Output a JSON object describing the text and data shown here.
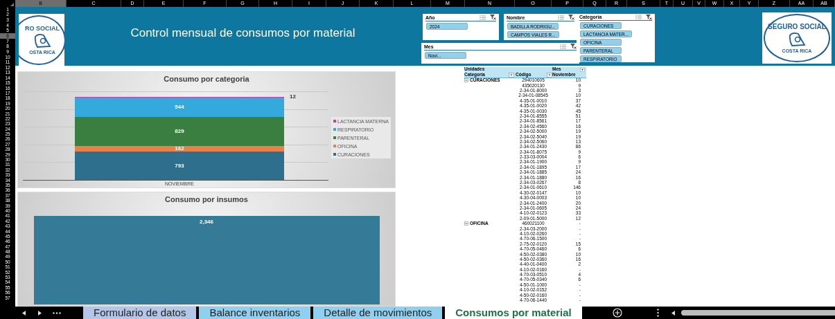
{
  "columns": [
    {
      "label": "B",
      "selected": true
    },
    {
      "label": "C",
      "selected": false
    },
    {
      "label": "D",
      "selected": false
    },
    {
      "label": "E",
      "selected": false
    },
    {
      "label": "F",
      "selected": false
    },
    {
      "label": "G",
      "selected": false
    },
    {
      "label": "H",
      "selected": false
    },
    {
      "label": "I",
      "selected": false
    },
    {
      "label": "J",
      "selected": false
    },
    {
      "label": "K",
      "selected": false
    },
    {
      "label": "L",
      "selected": false
    },
    {
      "label": "M",
      "selected": false
    },
    {
      "label": "N",
      "selected": false
    },
    {
      "label": "O",
      "selected": false
    },
    {
      "label": "P",
      "selected": false
    },
    {
      "label": "Q",
      "selected": false
    },
    {
      "label": "R",
      "selected": false
    },
    {
      "label": "S",
      "selected": false
    },
    {
      "label": "T",
      "selected": false
    },
    {
      "label": "U",
      "selected": false
    },
    {
      "label": "V",
      "selected": false
    },
    {
      "label": "W",
      "selected": false
    },
    {
      "label": "X",
      "selected": false
    },
    {
      "label": "Y",
      "selected": false
    },
    {
      "label": "Z",
      "selected": false
    },
    {
      "label": "AA",
      "selected": false
    },
    {
      "label": "AB",
      "selected": false
    }
  ],
  "rows": [
    {
      "label": "1",
      "selected": false
    },
    {
      "label": "2",
      "selected": false
    },
    {
      "label": "3",
      "selected": false
    },
    {
      "label": "4",
      "selected": false
    },
    {
      "label": "5",
      "selected": false
    },
    {
      "label": "6",
      "selected": true
    },
    {
      "label": "7",
      "selected": false
    },
    {
      "label": "8",
      "selected": false
    },
    {
      "label": "9",
      "selected": false
    },
    {
      "label": "10",
      "selected": false
    },
    {
      "label": "11",
      "selected": false
    },
    {
      "label": "12",
      "selected": false
    },
    {
      "label": "13",
      "selected": false
    },
    {
      "label": "14",
      "selected": false
    },
    {
      "label": "15",
      "selected": false
    },
    {
      "label": "16",
      "selected": false
    },
    {
      "label": "17",
      "selected": false
    },
    {
      "label": "18",
      "selected": false
    },
    {
      "label": "19",
      "selected": false
    },
    {
      "label": "20",
      "selected": false
    },
    {
      "label": "21",
      "selected": false
    },
    {
      "label": "22",
      "selected": false
    },
    {
      "label": "23",
      "selected": false
    },
    {
      "label": "24",
      "selected": false
    },
    {
      "label": "25",
      "selected": false
    },
    {
      "label": "26",
      "selected": false
    },
    {
      "label": "27",
      "selected": false
    },
    {
      "label": "28",
      "selected": false
    },
    {
      "label": "29",
      "selected": false
    },
    {
      "label": "30",
      "selected": false
    },
    {
      "label": "31",
      "selected": false
    },
    {
      "label": "32",
      "selected": false
    },
    {
      "label": "33",
      "selected": false
    },
    {
      "label": "34",
      "selected": false
    },
    {
      "label": "35",
      "selected": false
    },
    {
      "label": "36",
      "selected": false
    },
    {
      "label": "37",
      "selected": false
    },
    {
      "label": "38",
      "selected": false
    },
    {
      "label": "39",
      "selected": false
    },
    {
      "label": "40",
      "selected": false
    },
    {
      "label": "41",
      "selected": false
    },
    {
      "label": "42",
      "selected": false
    },
    {
      "label": "43",
      "selected": false
    },
    {
      "label": "44",
      "selected": false
    },
    {
      "label": "45",
      "selected": false
    },
    {
      "label": "46",
      "selected": false
    },
    {
      "label": "47",
      "selected": false
    },
    {
      "label": "48",
      "selected": false
    },
    {
      "label": "49",
      "selected": false
    },
    {
      "label": "50",
      "selected": false
    },
    {
      "label": "51",
      "selected": false
    },
    {
      "label": "52",
      "selected": false
    },
    {
      "label": "53",
      "selected": false
    },
    {
      "label": "54",
      "selected": false
    },
    {
      "label": "55",
      "selected": false
    },
    {
      "label": "56",
      "selected": false
    },
    {
      "label": "57",
      "selected": false
    }
  ],
  "header": {
    "title": "Control mensual de consumos por material",
    "left_logo": {
      "top_text": "RO SOCIAL",
      "bottom_text": "OSTA RICA"
    },
    "right_logo": {
      "top_text": "SEGURO SOCIAL",
      "bottom_text": "COSTA RICA"
    }
  },
  "slicers": [
    {
      "title": "Año",
      "items": [
        {
          "label": "2024",
          "selected": true
        }
      ]
    },
    {
      "title": "Nombre",
      "items": [
        {
          "label": "BADILLA RODRIGU...",
          "selected": true
        },
        {
          "label": "CAMPOS VIALES R...",
          "selected": true
        }
      ]
    },
    {
      "title": "Categoría",
      "items": [
        {
          "label": "CURACIONES",
          "selected": true
        },
        {
          "label": "LACTANCIA MATER...",
          "selected": true
        },
        {
          "label": "OFICINA",
          "selected": true
        },
        {
          "label": "PARENTERAL",
          "selected": true
        },
        {
          "label": "RESPIRATORIO",
          "selected": true
        }
      ]
    },
    {
      "title": "Mes",
      "items": [
        {
          "label": "Novi...",
          "selected": true
        }
      ]
    }
  ],
  "charts": [
    {
      "title": "Consumo por categoria",
      "category": "NOVIEMBRE",
      "segments": [
        {
          "name": "LACTANCIA MATERNA",
          "color": "#c23fa8",
          "label": "12"
        },
        {
          "name": "RESPIRATORIO",
          "color": "#35a9dc",
          "label": "544"
        },
        {
          "name": "PARENTERAL",
          "color": "#3a7f40",
          "label": "829"
        },
        {
          "name": "OFICINA",
          "color": "#e8804a",
          "label": "162"
        },
        {
          "name": "CURACIONES",
          "color": "#2e6f8e",
          "label": "793"
        }
      ]
    },
    {
      "title": "Consumo por insumos",
      "bar": {
        "label": "2,346",
        "color": "#357a96"
      }
    }
  ],
  "pivot": {
    "header": {
      "values_label": "Unidades",
      "category_label": "Categoría",
      "code_label": "Código",
      "month_label": "Mes",
      "month_value": "Noviembre"
    },
    "groups": [
      {
        "category": "CURACIONES",
        "expanded": true,
        "rows": [
          {
            "code": "294010605",
            "value": "10"
          },
          {
            "code": "435020130",
            "value": "9"
          },
          {
            "code": "2-34-01-8000",
            "value": "3"
          },
          {
            "code": "2-34-01-08545",
            "value": "10"
          },
          {
            "code": "4-35-01-0010",
            "value": "37"
          },
          {
            "code": "4-35-01-0020",
            "value": "42"
          },
          {
            "code": "4-35-01-0030",
            "value": "45"
          },
          {
            "code": "2-34-01-8555",
            "value": "51"
          },
          {
            "code": "2-34-01-8561",
            "value": "17"
          },
          {
            "code": "2-34-02-4560",
            "value": "16"
          },
          {
            "code": "2-34-02-5000",
            "value": "19"
          },
          {
            "code": "2-34-02-5040",
            "value": "19"
          },
          {
            "code": "2-34-02-5060",
            "value": "13"
          },
          {
            "code": "2-34-01-2430",
            "value": "86"
          },
          {
            "code": "2-34-01-8075",
            "value": "9"
          },
          {
            "code": "2-33-03-0004",
            "value": "6"
          },
          {
            "code": "2-34-01-1900",
            "value": "9"
          },
          {
            "code": "2-34-01-1895",
            "value": "17"
          },
          {
            "code": "2-34-01-1885",
            "value": "24"
          },
          {
            "code": "2-34-01-1880",
            "value": "16"
          },
          {
            "code": "2-34-03-0267",
            "value": "8"
          },
          {
            "code": "2-34-01-0610",
            "value": "146"
          },
          {
            "code": "4-30-02-0147",
            "value": "10"
          },
          {
            "code": "4-30-04-0003",
            "value": "10"
          },
          {
            "code": "2-34-01-2400",
            "value": "20"
          },
          {
            "code": "2-34-01-0605",
            "value": "24"
          },
          {
            "code": "4-10-02-0123",
            "value": "33"
          },
          {
            "code": "2-09-01-5000",
            "value": "12"
          }
        ]
      },
      {
        "category": "OFICINA",
        "expanded": true,
        "rows": [
          {
            "code": "460021100",
            "value": "-"
          },
          {
            "code": "2-34-03-2000",
            "value": "-"
          },
          {
            "code": "4-10-02-0260",
            "value": "-"
          },
          {
            "code": "4-70-06-1500",
            "value": "-"
          },
          {
            "code": "2-75-02-0120",
            "value": "15"
          },
          {
            "code": "4-70-05-0460",
            "value": "6"
          },
          {
            "code": "4-50-02-0380",
            "value": "10"
          },
          {
            "code": "4-50-02-0360",
            "value": "16"
          },
          {
            "code": "4-40-01-0400",
            "value": "2"
          },
          {
            "code": "4-10-02-0160",
            "value": "-"
          },
          {
            "code": "4-70-03-0510",
            "value": "4"
          },
          {
            "code": "4-70-05-0340",
            "value": "6"
          },
          {
            "code": "4-50-01-1000",
            "value": "-"
          },
          {
            "code": "4-10-02-0152",
            "value": "-"
          },
          {
            "code": "4-50-02-0160",
            "value": "-"
          },
          {
            "code": "4-70-06-1440",
            "value": "-"
          }
        ]
      }
    ]
  },
  "sheet_tabs": [
    {
      "label": "Formulario de datos",
      "selected": false,
      "color": "#b4c6e7"
    },
    {
      "label": "Balance inventarios",
      "selected": false,
      "color": "#8fd0f0"
    },
    {
      "label": "Detalle de movimientos",
      "selected": false,
      "color": "#8fd0f0"
    },
    {
      "label": "Consumos por material",
      "selected": true,
      "color": "#ffffff"
    }
  ]
}
